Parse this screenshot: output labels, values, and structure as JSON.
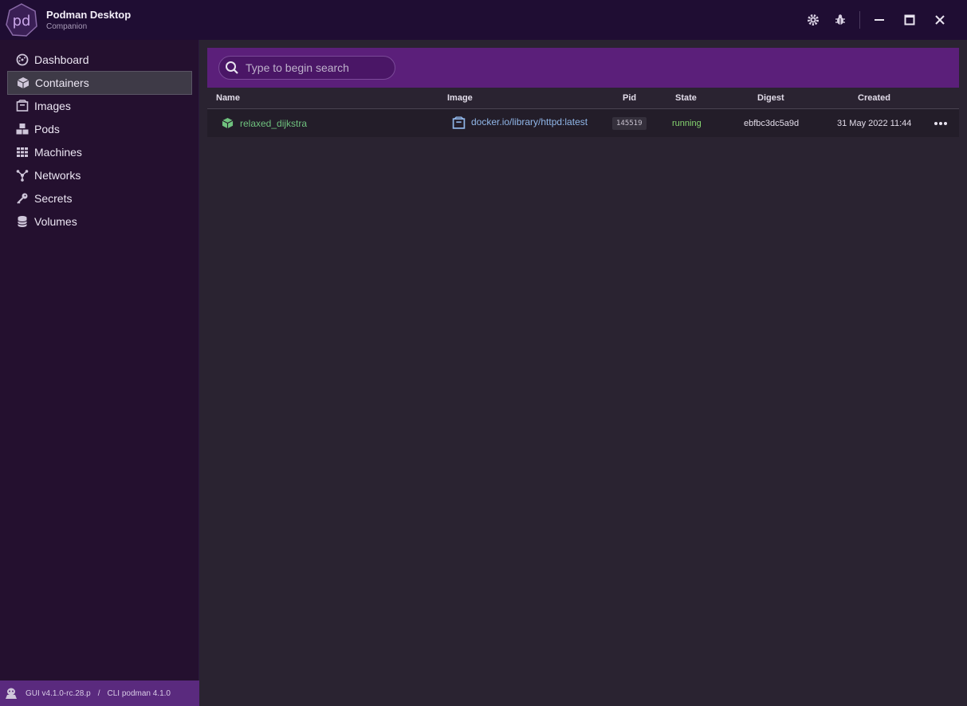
{
  "app": {
    "title": "Podman Desktop",
    "subtitle": "Companion",
    "logo_text": "pd"
  },
  "sidebar": {
    "items": [
      {
        "label": "Dashboard",
        "icon": "dashboard-icon",
        "active": false
      },
      {
        "label": "Containers",
        "icon": "cube-icon",
        "active": true
      },
      {
        "label": "Images",
        "icon": "image-box-icon",
        "active": false
      },
      {
        "label": "Pods",
        "icon": "cubes-icon",
        "active": false
      },
      {
        "label": "Machines",
        "icon": "grid-icon",
        "active": false
      },
      {
        "label": "Networks",
        "icon": "network-icon",
        "active": false
      },
      {
        "label": "Secrets",
        "icon": "key-icon",
        "active": false
      },
      {
        "label": "Volumes",
        "icon": "database-icon",
        "active": false
      }
    ]
  },
  "status": {
    "gui_version": "GUI v4.1.0-rc.28.p",
    "separator": "/",
    "cli_version": "CLI podman 4.1.0"
  },
  "search": {
    "placeholder": "Type to begin search"
  },
  "table": {
    "headers": {
      "name": "Name",
      "image": "Image",
      "pid": "Pid",
      "state": "State",
      "digest": "Digest",
      "created": "Created"
    },
    "rows": [
      {
        "name": "relaxed_dijkstra",
        "image": "docker.io/library/httpd:latest",
        "pid": "145519",
        "state": "running",
        "digest": "ebfbc3dc5a9d",
        "created": "31 May 2022 11:44",
        "actions_icon": "ellipsis-icon"
      }
    ]
  },
  "colors": {
    "accent": "#5b1f7a",
    "running": "#86d670",
    "container_name": "#6fc27e",
    "image_link": "#90b6e8",
    "status_bar": "#5a2a7e"
  }
}
